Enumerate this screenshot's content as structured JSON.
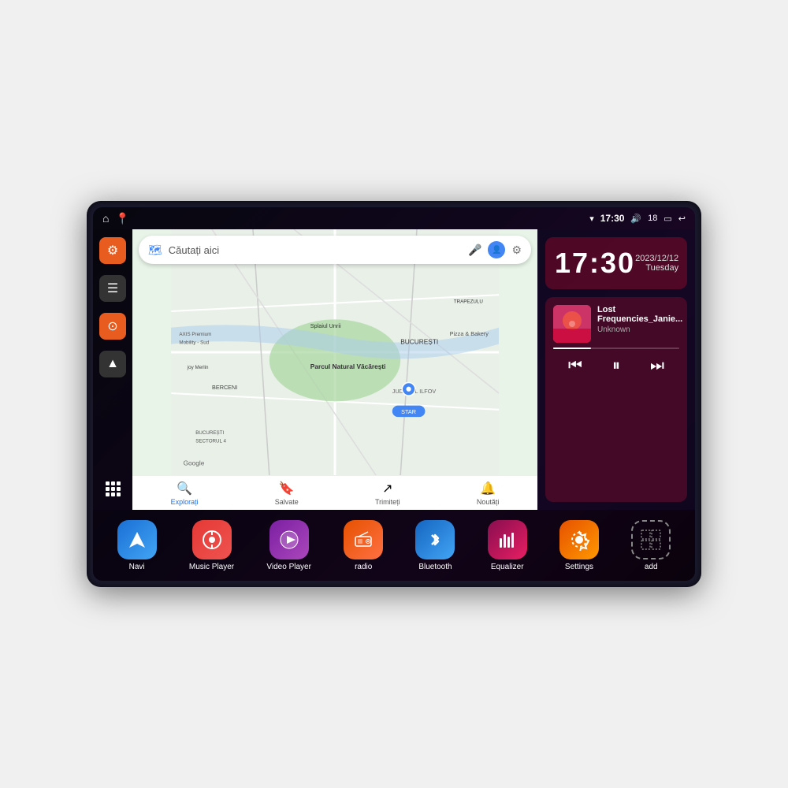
{
  "device": {
    "status_bar": {
      "left_icons": [
        "home",
        "map-pin"
      ],
      "wifi_icon": "wifi",
      "time": "17:30",
      "volume_icon": "volume",
      "battery_level": "18",
      "battery_icon": "battery",
      "back_icon": "back"
    },
    "sidebar": {
      "buttons": [
        {
          "id": "settings",
          "icon": "⚙",
          "color": "orange"
        },
        {
          "id": "folder",
          "icon": "▤",
          "color": "dark"
        },
        {
          "id": "location",
          "icon": "◉",
          "color": "orange"
        },
        {
          "id": "nav",
          "icon": "▲",
          "color": "dark"
        }
      ],
      "apps_grid_label": "apps"
    },
    "map": {
      "search_placeholder": "Căutați aici",
      "bottom_nav": [
        {
          "icon": "🔍",
          "label": "Explorați",
          "active": true
        },
        {
          "icon": "🔖",
          "label": "Salvate",
          "active": false
        },
        {
          "icon": "↗",
          "label": "Trimiteți",
          "active": false
        },
        {
          "icon": "🔔",
          "label": "Noutăți",
          "active": false
        }
      ]
    },
    "clock": {
      "time": "17:30",
      "date": "2023/12/12",
      "day": "Tuesday"
    },
    "music": {
      "title": "Lost Frequencies_Janie...",
      "artist": "Unknown",
      "controls": {
        "prev": "⏮",
        "play_pause": "⏸",
        "next": "⏭"
      }
    },
    "apps_dock": [
      {
        "id": "navi",
        "label": "Navi",
        "icon": "▲",
        "style": "navi"
      },
      {
        "id": "music-player",
        "label": "Music Player",
        "icon": "♪",
        "style": "music"
      },
      {
        "id": "video-player",
        "label": "Video Player",
        "icon": "▶",
        "style": "video"
      },
      {
        "id": "radio",
        "label": "radio",
        "icon": "📻",
        "style": "radio"
      },
      {
        "id": "bluetooth",
        "label": "Bluetooth",
        "icon": "⚡",
        "style": "bluetooth"
      },
      {
        "id": "equalizer",
        "label": "Equalizer",
        "icon": "📊",
        "style": "equalizer"
      },
      {
        "id": "settings",
        "label": "Settings",
        "icon": "⚙",
        "style": "settings"
      },
      {
        "id": "add",
        "label": "add",
        "icon": "+",
        "style": "add"
      }
    ]
  }
}
